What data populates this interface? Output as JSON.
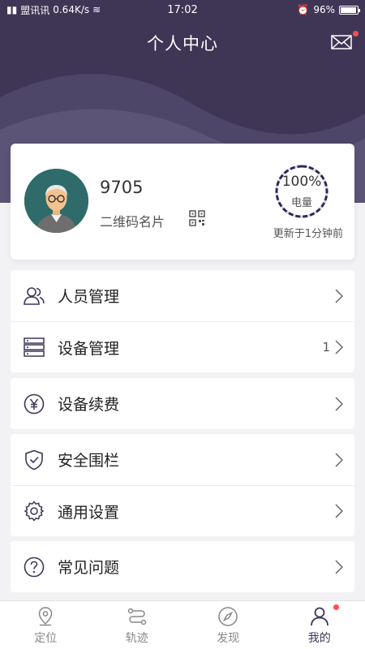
{
  "status_bar": {
    "carrier": "盟讯讯 ",
    "speed": "0.64K/s",
    "time": "17:02",
    "battery": "96%",
    "battery_level": 0.96
  },
  "header": {
    "title": "个人中心",
    "background": "#3f3656"
  },
  "profile": {
    "name": "9705",
    "qr_label": "二维码名片",
    "battery_percent": "100%",
    "battery_level": 1.0,
    "battery_label": "电量",
    "update_text": "更新于1分钟前"
  },
  "menu": {
    "group1": [
      {
        "label": "人员管理",
        "icon": "people-icon",
        "badge": ""
      },
      {
        "label": "设备管理",
        "icon": "device-icon",
        "badge": "1"
      }
    ],
    "group2": [
      {
        "label": "设备续费",
        "icon": "yuan-icon",
        "badge": ""
      }
    ],
    "group3": [
      {
        "label": "安全围栏",
        "icon": "shield-icon",
        "badge": ""
      },
      {
        "label": "通用设置",
        "icon": "gear-icon",
        "badge": ""
      }
    ],
    "group4": [
      {
        "label": "常见问题",
        "icon": "question-icon",
        "badge": ""
      }
    ]
  },
  "tabs": [
    {
      "label": "定位",
      "icon": "location-icon"
    },
    {
      "label": "轨迹",
      "icon": "track-icon"
    },
    {
      "label": "发现",
      "icon": "compass-icon"
    },
    {
      "label": "我的",
      "icon": "person-icon",
      "active": true
    }
  ],
  "colors": {
    "accent": "#3f3656",
    "notification_dot": "#ff4d4f",
    "ring": "#2d2a5a"
  }
}
